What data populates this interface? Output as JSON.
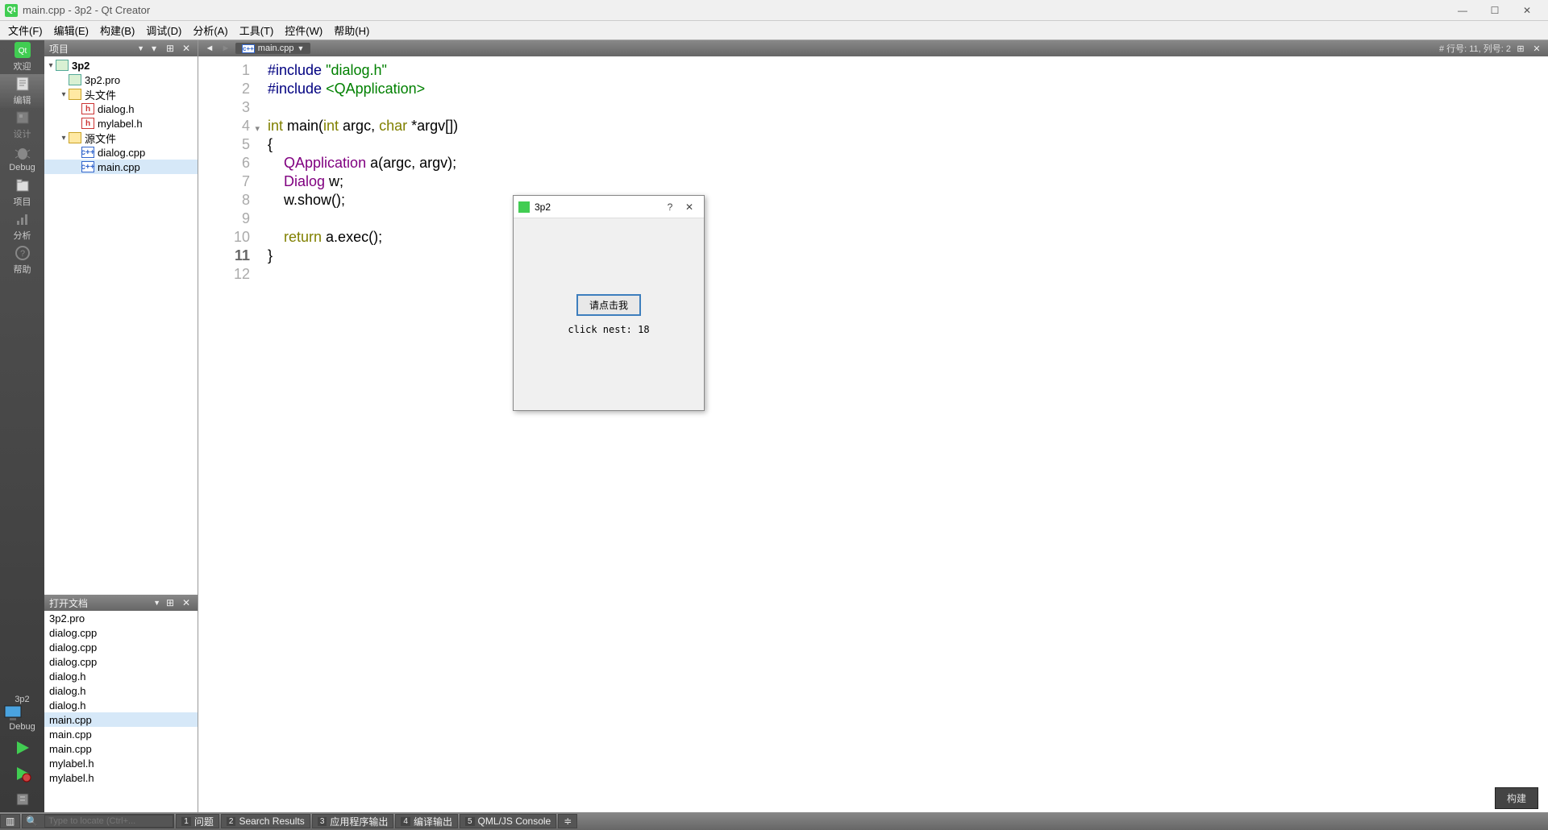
{
  "window": {
    "title": "main.cpp - 3p2 - Qt Creator",
    "minimize": "—",
    "maximize": "☐",
    "close": "✕"
  },
  "menubar": [
    "文件(F)",
    "编辑(E)",
    "构建(B)",
    "调试(D)",
    "分析(A)",
    "工具(T)",
    "控件(W)",
    "帮助(H)"
  ],
  "modebar": {
    "items": [
      {
        "label": "欢迎",
        "icon": "qt"
      },
      {
        "label": "编辑",
        "icon": "edit",
        "active": true
      },
      {
        "label": "设计",
        "icon": "design",
        "dim": true
      },
      {
        "label": "Debug",
        "icon": "bug"
      },
      {
        "label": "项目",
        "icon": "proj"
      },
      {
        "label": "分析",
        "icon": "chart"
      },
      {
        "label": "帮助",
        "icon": "help"
      }
    ],
    "target": "3p2",
    "config": "Debug"
  },
  "project_panel": {
    "title": "项目",
    "root": "3p2",
    "pro": "3p2.pro",
    "headers_label": "头文件",
    "headers": [
      "dialog.h",
      "mylabel.h"
    ],
    "sources_label": "源文件",
    "sources": [
      "dialog.cpp",
      "main.cpp"
    ],
    "selected": "main.cpp"
  },
  "open_docs": {
    "title": "打开文档",
    "items": [
      "3p2.pro",
      "dialog.cpp",
      "dialog.cpp",
      "dialog.cpp",
      "dialog.h",
      "dialog.h",
      "dialog.h",
      "main.cpp",
      "main.cpp",
      "main.cpp",
      "mylabel.h",
      "mylabel.h"
    ],
    "selected_index": 7
  },
  "editor": {
    "file_tab": "main.cpp",
    "cursor_info": "# 行号: 11, 列号: 2",
    "code_lines": [
      {
        "n": 1,
        "html": "<span class='pp'>#include</span> <span class='inc'>\"dialog.h\"</span>"
      },
      {
        "n": 2,
        "html": "<span class='pp'>#include</span> <span class='inc'>&lt;QApplication&gt;</span>"
      },
      {
        "n": 3,
        "html": ""
      },
      {
        "n": 4,
        "html": "<span class='kw'>int</span> main(<span class='kw'>int</span> argc, <span class='kw'>char</span> *argv[])",
        "fold": true
      },
      {
        "n": 5,
        "html": "{"
      },
      {
        "n": 6,
        "html": "    <span class='type'>QApplication</span> a(argc, argv);"
      },
      {
        "n": 7,
        "html": "    <span class='type'>Dialog</span> w;"
      },
      {
        "n": 8,
        "html": "    w.show();"
      },
      {
        "n": 9,
        "html": ""
      },
      {
        "n": 10,
        "html": "    <span class='kw'>return</span> a.exec();"
      },
      {
        "n": 11,
        "html": "}",
        "current": true
      },
      {
        "n": 12,
        "html": ""
      }
    ]
  },
  "run_dialog": {
    "title": "3p2",
    "help": "?",
    "close": "✕",
    "button": "请点击我",
    "label": "click nest: 18"
  },
  "statusbar": {
    "locator_placeholder": "Type to locate (Ctrl+...",
    "panes": [
      {
        "n": "1",
        "t": "问题"
      },
      {
        "n": "2",
        "t": "Search Results"
      },
      {
        "n": "3",
        "t": "应用程序输出"
      },
      {
        "n": "4",
        "t": "编译输出"
      },
      {
        "n": "5",
        "t": "QML/JS Console"
      }
    ],
    "build": "构建"
  }
}
